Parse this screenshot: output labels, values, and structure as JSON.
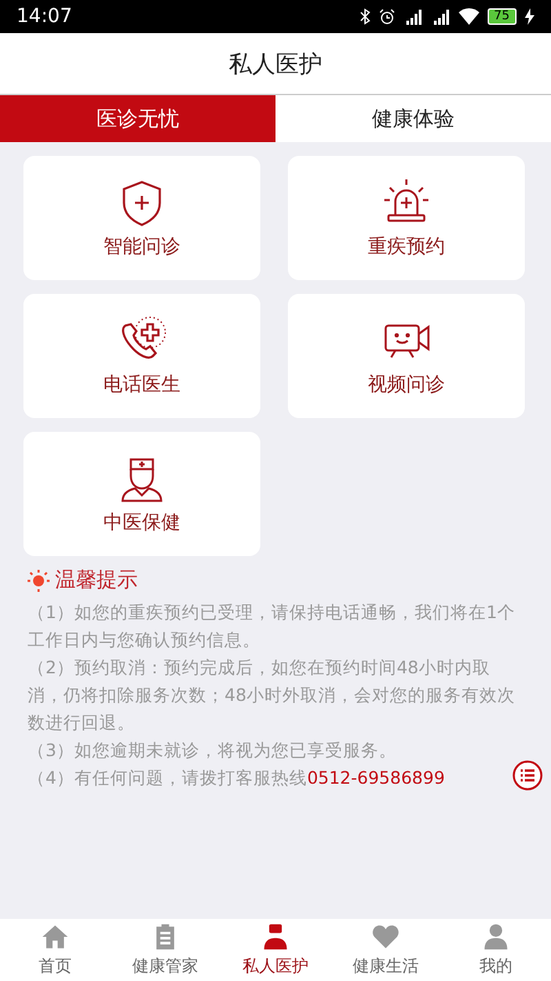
{
  "status_bar": {
    "time": "14:07",
    "battery": "75"
  },
  "header": {
    "title": "私人医护"
  },
  "tabs": [
    {
      "label": "医诊无忧",
      "selected": true
    },
    {
      "label": "健康体验",
      "selected": false
    }
  ],
  "services": [
    {
      "label": "智能问诊"
    },
    {
      "label": "重疾预约"
    },
    {
      "label": "电话医生"
    },
    {
      "label": "视频问诊"
    },
    {
      "label": "中医保健"
    }
  ],
  "tips": {
    "title": "温馨提示",
    "items": [
      {
        "text": "（1）如您的重疾预约已受理，请保持电话通畅，我们将在1个工作日内与您确认预约信息。"
      },
      {
        "text": "（2）预约取消：预约完成后，如您在预约时间48小时内取消，仍将扣除服务次数；48小时外取消，会对您的服务有效次数进行回退。"
      },
      {
        "text": "（3）如您逾期未就诊，将视为您已享受服务。"
      },
      {
        "text": "（4）有任何问题，请拨打客服热线",
        "hotline": "0512-69586899"
      }
    ]
  },
  "bottom_nav": [
    {
      "label": "首页",
      "selected": false
    },
    {
      "label": "健康管家",
      "selected": false
    },
    {
      "label": "私人医护",
      "selected": true
    },
    {
      "label": "健康生活",
      "selected": false
    },
    {
      "label": "我的",
      "selected": false
    }
  ]
}
